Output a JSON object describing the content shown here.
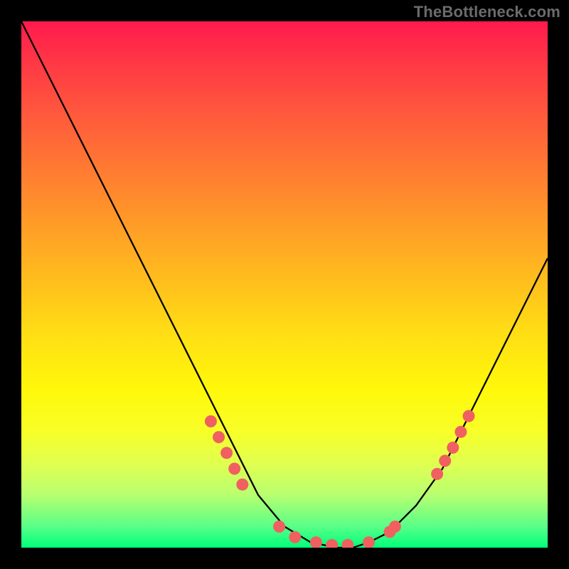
{
  "watermark": "TheBottleneck.com",
  "colors": {
    "background": "#000000",
    "curve": "#000000",
    "marker": "#f06060",
    "gradient_top": "#ff1a4d",
    "gradient_bottom": "#00ff7a"
  },
  "chart_data": {
    "type": "line",
    "title": "",
    "xlabel": "",
    "ylabel": "",
    "xlim": [
      0,
      100
    ],
    "ylim": [
      0,
      100
    ],
    "x": [
      0,
      5,
      10,
      15,
      20,
      25,
      30,
      35,
      40,
      45,
      50,
      55,
      60,
      63,
      66,
      70,
      75,
      80,
      85,
      90,
      95,
      100
    ],
    "series": [
      {
        "name": "bottleneck-curve",
        "values": [
          100,
          90,
          80,
          70,
          60,
          50,
          40,
          30,
          20,
          10,
          4,
          1,
          0,
          0,
          1,
          3,
          8,
          15,
          25,
          35,
          45,
          55
        ]
      }
    ],
    "markers": [
      {
        "x": 36,
        "y": 24
      },
      {
        "x": 37.5,
        "y": 21
      },
      {
        "x": 39,
        "y": 18
      },
      {
        "x": 40.5,
        "y": 15
      },
      {
        "x": 42,
        "y": 12
      },
      {
        "x": 49,
        "y": 4
      },
      {
        "x": 52,
        "y": 2
      },
      {
        "x": 56,
        "y": 1
      },
      {
        "x": 59,
        "y": 0.5
      },
      {
        "x": 62,
        "y": 0.5
      },
      {
        "x": 66,
        "y": 1
      },
      {
        "x": 70,
        "y": 3
      },
      {
        "x": 71,
        "y": 4
      },
      {
        "x": 79,
        "y": 14
      },
      {
        "x": 80.5,
        "y": 16.5
      },
      {
        "x": 82,
        "y": 19
      },
      {
        "x": 83.5,
        "y": 22
      },
      {
        "x": 85,
        "y": 25
      }
    ]
  }
}
